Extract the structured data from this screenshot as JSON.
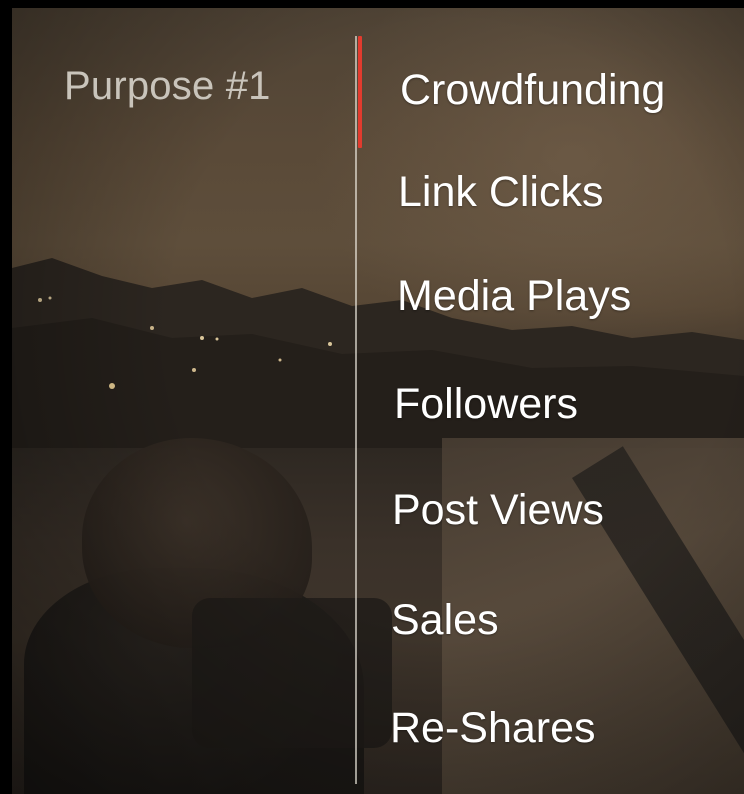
{
  "purpose": {
    "label": "Purpose #1"
  },
  "metrics": {
    "items": [
      {
        "label": "Crowdfunding"
      },
      {
        "label": "Link Clicks"
      },
      {
        "label": "Media Plays"
      },
      {
        "label": "Followers"
      },
      {
        "label": "Post Views"
      },
      {
        "label": "Sales"
      },
      {
        "label": "Re-Shares"
      }
    ],
    "active_index": 0
  },
  "colors": {
    "accent": "#e23b2e",
    "label_muted": "#c9c4bb",
    "metric_text": "#ffffff"
  }
}
